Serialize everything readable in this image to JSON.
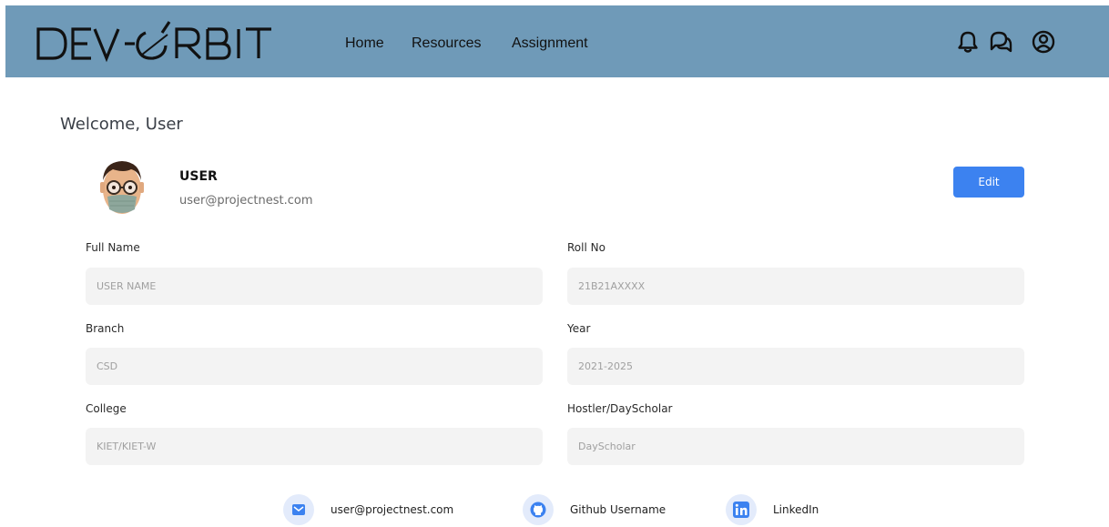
{
  "header": {
    "logo_text": "DEV-ORBIT",
    "nav": [
      "Home",
      "Resources",
      "Assignment"
    ],
    "icons": [
      "bell-icon",
      "chat-icon",
      "user-circle-icon"
    ],
    "background": "#6f9ab8"
  },
  "profile": {
    "welcome": "Welcome, User",
    "name": "USER",
    "email": "user@projectnest.com",
    "edit_label": "Edit"
  },
  "form": {
    "full_name": {
      "label": "Full Name",
      "placeholder": "USER NAME"
    },
    "roll_no": {
      "label": "Roll No",
      "placeholder": "21B21AXXXX"
    },
    "branch": {
      "label": "Branch",
      "placeholder": "CSD"
    },
    "year": {
      "label": "Year",
      "placeholder": "2021-2025"
    },
    "college": {
      "label": "College",
      "placeholder": "KIET/KIET-W"
    },
    "residence": {
      "label": "Hostler/DayScholar",
      "placeholder": "DayScholar"
    }
  },
  "social": {
    "email": "user@projectnest.com",
    "github": "Github Username",
    "linkedin": "LinkedIn"
  },
  "colors": {
    "accent": "#3c82f0",
    "field_bg": "#f3f3f3"
  }
}
